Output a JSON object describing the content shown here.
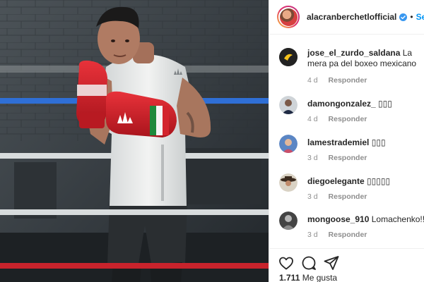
{
  "post": {
    "username": "alacranberchetlofficial",
    "follow_label": "Seguir",
    "separator": "•",
    "photo_description_icon": "boxer-photo"
  },
  "comments": [
    {
      "user": "jose_el_zurdo_saldana",
      "text": "La mera pa del boxeo mexicano",
      "time": "4 d",
      "reply": "Responder",
      "avatar": "logo-avatar"
    },
    {
      "user": "damongonzalez_",
      "text": "▯▯▯",
      "time": "4 d",
      "reply": "Responder",
      "avatar": "man-avatar"
    },
    {
      "user": "lamestrademiel",
      "text": "▯▯▯",
      "time": "3 d",
      "reply": "Responder",
      "avatar": "woman-avatar"
    },
    {
      "user": "diegoelegante",
      "text": "▯▯▯▯▯",
      "time": "3 d",
      "reply": "Responder",
      "avatar": "hat-avatar"
    },
    {
      "user": "mongoose_910",
      "text": "Lomachenko!!!!",
      "time": "3 d",
      "reply": "Responder",
      "avatar": "fighter-avatar"
    }
  ],
  "footer": {
    "likes_count": "1.711",
    "likes_label": "Me gusta"
  },
  "colors": {
    "link_blue": "#0095f6",
    "meta_gray": "#8e8e8e",
    "text": "#262626",
    "divider": "#efefef"
  }
}
